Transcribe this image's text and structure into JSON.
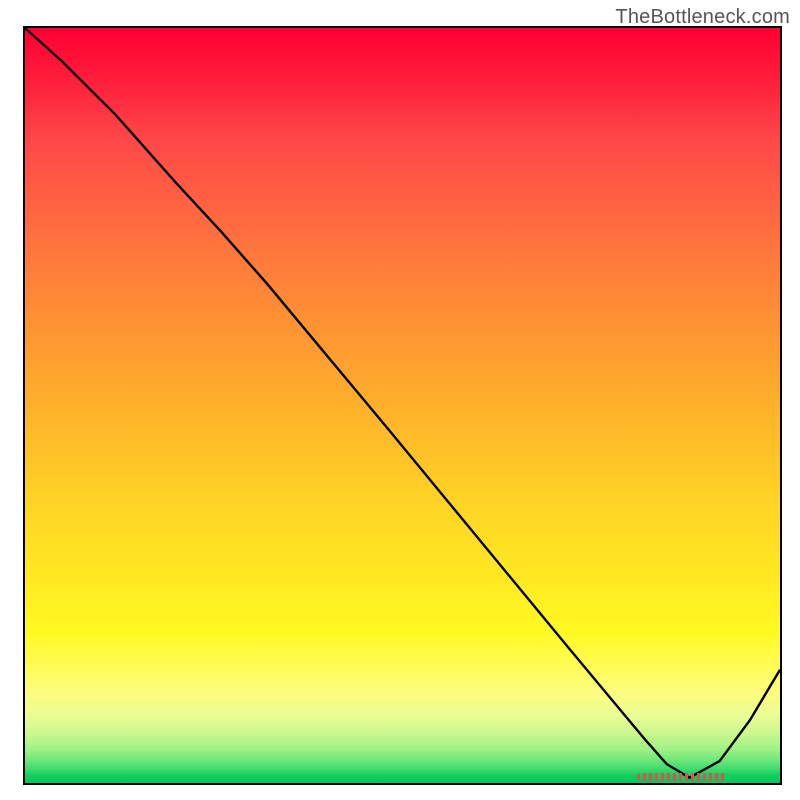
{
  "attribution": "TheBottleneck.com",
  "colors": {
    "top": "#ff0033",
    "bottom": "#04c65b",
    "line": "#000000",
    "marker": "#d9544f"
  },
  "chart_data": {
    "type": "line",
    "title": "",
    "xlabel": "",
    "ylabel": "",
    "xlim": [
      0,
      100
    ],
    "ylim": [
      0,
      100
    ],
    "x": [
      0,
      5,
      12,
      20,
      26,
      32,
      40,
      48,
      56,
      64,
      72,
      78,
      82,
      85,
      88,
      92,
      96,
      100
    ],
    "values": [
      100,
      95.5,
      88.5,
      79.5,
      73.0,
      66.2,
      56.6,
      47.0,
      37.3,
      27.6,
      17.9,
      10.7,
      5.9,
      2.5,
      0.7,
      2.9,
      8.3,
      15.0
    ],
    "background_gradient": "vertical red→orange→yellow→green",
    "optimal_marker": {
      "x_start": 81,
      "x_end": 93,
      "y": 0.8
    }
  }
}
